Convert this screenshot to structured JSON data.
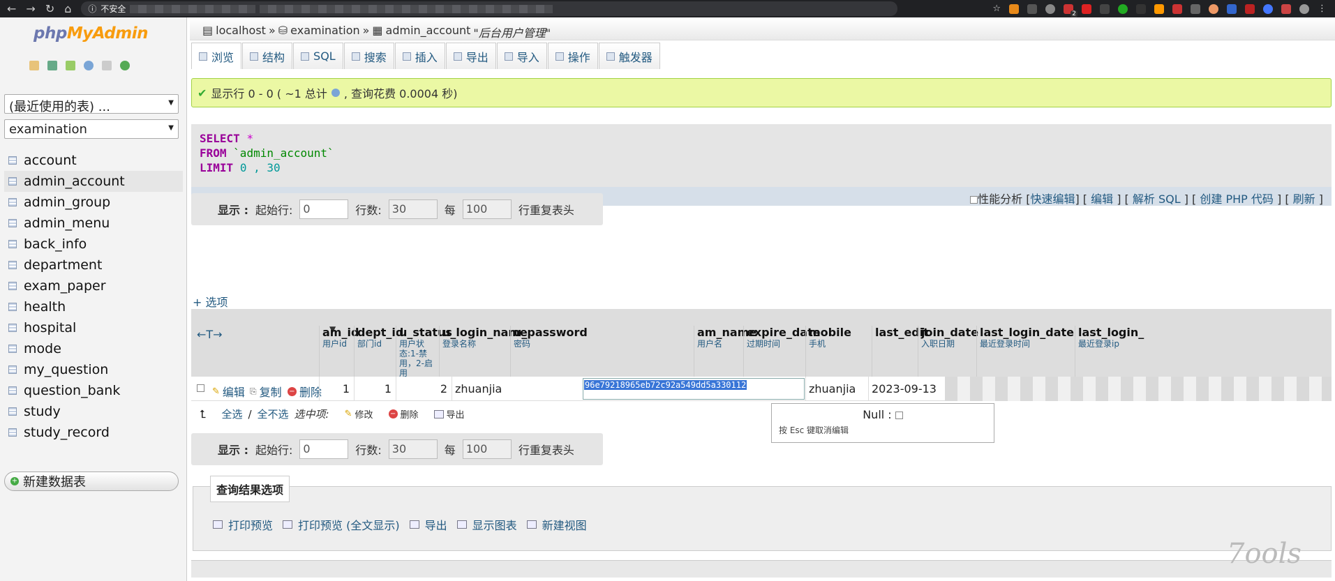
{
  "browser": {
    "security_label": "不安全",
    "extension_badge": "2"
  },
  "sidebar": {
    "logo_php": "php",
    "logo_myadmin": "MyAdmin",
    "recent_tables": "(最近使用的表) ...",
    "database": "examination",
    "tables": [
      "account",
      "admin_account",
      "admin_group",
      "admin_menu",
      "back_info",
      "department",
      "exam_paper",
      "health",
      "hospital",
      "mode",
      "my_question",
      "question_bank",
      "study",
      "study_record"
    ],
    "active_table": "admin_account",
    "new_table": "新建数据表"
  },
  "breadcrumb": {
    "server": "localhost",
    "sep1": "»",
    "database": "examination",
    "sep2": "»",
    "table": "admin_account",
    "comment": "\"后台用户管理\""
  },
  "tabs": [
    "浏览",
    "结构",
    "SQL",
    "搜索",
    "插入",
    "导出",
    "导入",
    "操作",
    "触发器"
  ],
  "message": {
    "prefix": "显示行 0 - 0 ( ~1 总计",
    "suffix": ", 查询花费 0.0004 秒)"
  },
  "sql": {
    "select_kw": "SELECT",
    "star": "*",
    "from_kw": "FROM",
    "table": "`admin_account`",
    "limit_kw": "LIMIT",
    "limit_vals": "0 , 30"
  },
  "sql_links": {
    "profiling": "性能分析",
    "inline_edit": "快速编辑",
    "edit": "编辑",
    "explain": "解析 SQL",
    "php_code": "创建 PHP 代码",
    "refresh": "刷新"
  },
  "navigation": {
    "show_label": "显示 :",
    "start_label": "起始行:",
    "start_value": "0",
    "rows_label": "行数:",
    "rows_value": "30",
    "per_label": "每",
    "per_value": "100",
    "repeat_label": "行重复表头"
  },
  "options_link": "+ 选项",
  "arrows": "←T→",
  "columns": [
    {
      "name": "am_id",
      "comment": "用户id"
    },
    {
      "name": "dept_id",
      "comment": "部门id"
    },
    {
      "name": "u_status",
      "comment": "用户状态:1-禁用，2-启用"
    },
    {
      "name": "u_login_name",
      "comment": "登录名称"
    },
    {
      "name": "u_password",
      "comment": "密码"
    },
    {
      "name": "am_name",
      "comment": "用户名"
    },
    {
      "name": "expire_date",
      "comment": "过期时间"
    },
    {
      "name": "mobile",
      "comment": "手机"
    },
    {
      "name": "last_edit",
      "comment": ""
    },
    {
      "name": "join_date",
      "comment": "入职日期"
    },
    {
      "name": "last_login_date",
      "comment": "最近登录时间"
    },
    {
      "name": "last_login_",
      "comment": "最近登录ip"
    }
  ],
  "row": {
    "actions": {
      "edit": "编辑",
      "copy": "复制",
      "delete": "删除"
    },
    "am_id": "1",
    "dept_id": "1",
    "u_status": "2",
    "u_login_name": "zhuanjia",
    "u_password": "96e79218965eb72c92a549dd5a330112",
    "am_name": "zhuanjia",
    "expire_date": "2023-09-13"
  },
  "edit_popup": {
    "null_label": "Null :",
    "hint": "按 Esc 键取消编辑"
  },
  "bulk": {
    "check_all": "全选",
    "sep": "/",
    "uncheck_all": "全不选",
    "with_selected": "选中项:",
    "modify": "修改",
    "delete": "删除",
    "export": "导出"
  },
  "query_results": {
    "legend": "查询结果选项",
    "print": "打印预览",
    "print_full": "打印预览 (全文显示)",
    "export": "导出",
    "chart": "显示图表",
    "view": "新建视图"
  },
  "watermark": "7ools"
}
